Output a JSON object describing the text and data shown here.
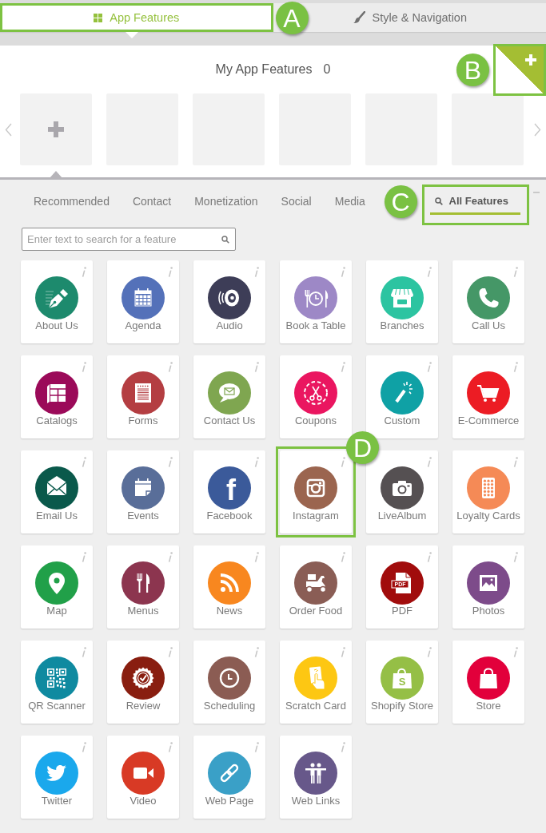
{
  "tabs": [
    {
      "label": "App Features",
      "kind": "grid",
      "selected": true,
      "marker": "A"
    },
    {
      "label": "Style & Navigation",
      "kind": "brush",
      "selected": false
    }
  ],
  "my_features": {
    "title": "My App Features",
    "count": "0",
    "add_corner": {
      "marker": "B"
    },
    "slots": [
      {
        "kind": "add"
      },
      {
        "kind": "empty"
      },
      {
        "kind": "empty"
      },
      {
        "kind": "empty"
      },
      {
        "kind": "empty"
      },
      {
        "kind": "empty"
      }
    ]
  },
  "categories": [
    {
      "label": "Recommended",
      "kind": "text",
      "selected": false
    },
    {
      "label": "Contact",
      "kind": "text",
      "selected": false
    },
    {
      "label": "Monetization",
      "kind": "text",
      "selected": false
    },
    {
      "label": "Social",
      "kind": "text",
      "selected": false
    },
    {
      "label": "Media",
      "kind": "text",
      "selected": false
    },
    {
      "label": "All Features",
      "kind": "search",
      "selected": true,
      "marker": "C"
    }
  ],
  "search": {
    "placeholder": "Enter text to search for a feature"
  },
  "features": [
    {
      "label": "About Us",
      "kind": "pen",
      "color": "#1d8a6d"
    },
    {
      "label": "Agenda",
      "kind": "calendar",
      "color": "#5471b9"
    },
    {
      "label": "Audio",
      "kind": "speaker",
      "color": "#3d3d57"
    },
    {
      "label": "Book a Table",
      "kind": "dining",
      "color": "#9d88c6"
    },
    {
      "label": "Branches",
      "kind": "store",
      "color": "#2cc4a1"
    },
    {
      "label": "Call Us",
      "kind": "phone",
      "color": "#459767"
    },
    {
      "label": "Catalogs",
      "kind": "booklet",
      "color": "#9b0a59"
    },
    {
      "label": "Forms",
      "kind": "form",
      "color": "#b43e42"
    },
    {
      "label": "Contact Us",
      "kind": "chat",
      "color": "#7fa650"
    },
    {
      "label": "Coupons",
      "kind": "scissors",
      "color": "#ea1660"
    },
    {
      "label": "Custom",
      "kind": "wand",
      "color": "#0fa1a5"
    },
    {
      "label": "E-Commerce",
      "kind": "cart",
      "color": "#ec1c24"
    },
    {
      "label": "Email Us",
      "kind": "envelope",
      "color": "#0a594b"
    },
    {
      "label": "Events",
      "kind": "notepad",
      "color": "#596e99"
    },
    {
      "label": "Facebook",
      "kind": "letter",
      "glyph": "f",
      "color": "#3b5a9a"
    },
    {
      "label": "Instagram",
      "kind": "lens",
      "color": "#9b654f",
      "marker": "D"
    },
    {
      "label": "LiveAlbum",
      "kind": "camera",
      "color": "#555052"
    },
    {
      "label": "Loyalty Cards",
      "kind": "card",
      "color": "#f58a56"
    },
    {
      "label": "Map",
      "kind": "pin",
      "color": "#21a049"
    },
    {
      "label": "Menus",
      "kind": "cutlery",
      "color": "#8c354f"
    },
    {
      "label": "News",
      "kind": "rss",
      "color": "#f8871f"
    },
    {
      "label": "Order Food",
      "kind": "scooter",
      "color": "#8a5d55"
    },
    {
      "label": "PDF",
      "kind": "pdf",
      "glyph": "PDF",
      "color": "#a10c0c"
    },
    {
      "label": "Photos",
      "kind": "picture",
      "color": "#7d4b8a"
    },
    {
      "label": "QR Scanner",
      "kind": "qr",
      "color": "#0f8aa0"
    },
    {
      "label": "Review",
      "kind": "seal",
      "color": "#891e10"
    },
    {
      "label": "Scheduling",
      "kind": "clock",
      "color": "#8b5c53"
    },
    {
      "label": "Scratch Card",
      "kind": "tap",
      "color": "#fdc713"
    },
    {
      "label": "Shopify Store",
      "kind": "bagletter",
      "glyph": "S",
      "color": "#95bf46"
    },
    {
      "label": "Store",
      "kind": "bag",
      "color": "#e2003b"
    },
    {
      "label": "Twitter",
      "kind": "bird",
      "color": "#1aa8ec"
    },
    {
      "label": "Video",
      "kind": "video",
      "color": "#d83a25"
    },
    {
      "label": "Web Page",
      "kind": "link",
      "color": "#3aa0c7"
    },
    {
      "label": "Web Links",
      "kind": "people",
      "color": "#67588a"
    }
  ]
}
